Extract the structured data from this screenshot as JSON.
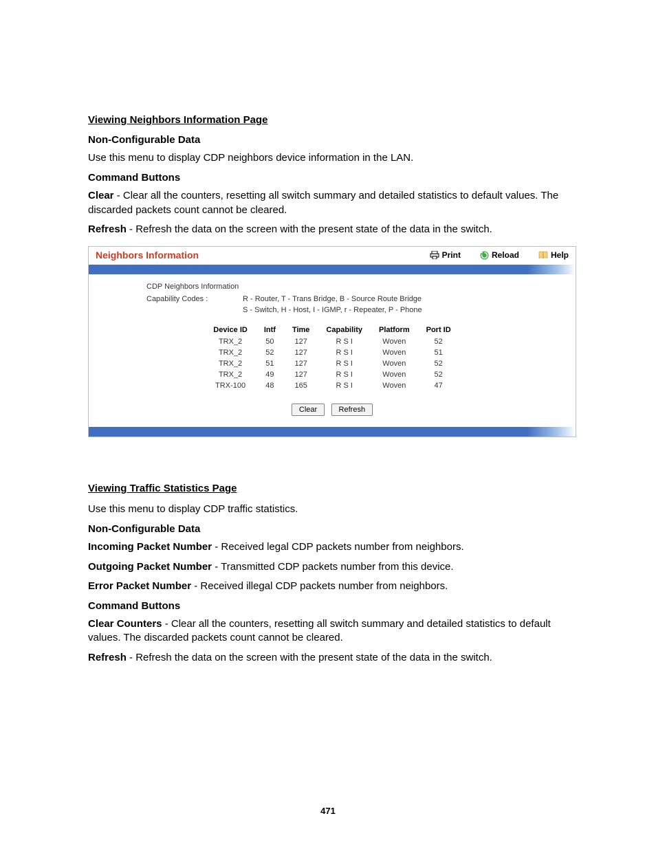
{
  "section1": {
    "heading": "Viewing Neighbors Information Page",
    "subhead_noncfg": "Non-Configurable Data",
    "noncfg_text": "Use this menu to display CDP neighbors device information in the LAN.",
    "subhead_cmd": "Command Buttons",
    "cmd_clear_label": "Clear",
    "cmd_clear_text": " - Clear all the counters, resetting all switch summary and detailed statistics to default values. The discarded packets count cannot be cleared.",
    "cmd_refresh_label": "Refresh",
    "cmd_refresh_text": " - Refresh the data on the screen with the present state of the data in the switch."
  },
  "panel": {
    "title": "Neighbors Information",
    "print": "Print",
    "reload": "Reload",
    "help": "Help",
    "cdp_caption": "CDP Neighbors Information",
    "capcodes_label": "Capability Codes :",
    "capcodes_line1": "R - Router, T - Trans Bridge, B - Source Route Bridge",
    "capcodes_line2": "S - Switch, H - Host, I - IGMP, r - Repeater, P - Phone",
    "cols": {
      "device_id": "Device ID",
      "intf": "Intf",
      "time": "Time",
      "capability": "Capability",
      "platform": "Platform",
      "port_id": "Port ID"
    },
    "rows": [
      {
        "device_id": "TRX_2",
        "intf": "50",
        "time": "127",
        "cap": "R S I",
        "platform": "Woven",
        "port_id": "52"
      },
      {
        "device_id": "TRX_2",
        "intf": "52",
        "time": "127",
        "cap": "R S I",
        "platform": "Woven",
        "port_id": "51"
      },
      {
        "device_id": "TRX_2",
        "intf": "51",
        "time": "127",
        "cap": "R S I",
        "platform": "Woven",
        "port_id": "52"
      },
      {
        "device_id": "TRX_2",
        "intf": "49",
        "time": "127",
        "cap": "R S I",
        "platform": "Woven",
        "port_id": "52"
      },
      {
        "device_id": "TRX-100",
        "intf": "48",
        "time": "165",
        "cap": "R S I",
        "platform": "Woven",
        "port_id": "47"
      }
    ],
    "btn_clear": "Clear",
    "btn_refresh": "Refresh"
  },
  "section2": {
    "heading": "Viewing Traffic Statistics Page",
    "intro": "Use this menu to display CDP traffic statistics.",
    "subhead_noncfg": "Non-Configurable Data",
    "items": [
      {
        "label": "Incoming Packet Number",
        "text": " - Received legal CDP packets number from neighbors."
      },
      {
        "label": "Outgoing Packet Number",
        "text": " - Transmitted CDP packets number from this device."
      },
      {
        "label": "Error Packet Number",
        "text": " - Received illegal CDP packets number from neighbors."
      }
    ],
    "subhead_cmd": "Command Buttons",
    "cmd_clear_label": "Clear Counters",
    "cmd_clear_text": " - Clear all the counters, resetting all switch summary and detailed statistics to default values. The discarded packets count cannot be cleared.",
    "cmd_refresh_label": "Refresh",
    "cmd_refresh_text": " - Refresh the data on the screen with the present state of the data in the switch."
  },
  "page_number": "471"
}
